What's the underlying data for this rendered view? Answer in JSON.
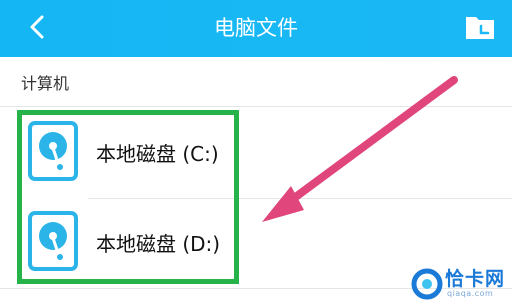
{
  "header": {
    "title": "电脑文件",
    "bg_color": "#1ab9f5"
  },
  "section": {
    "label": "计算机"
  },
  "disks": [
    {
      "label": "本地磁盘 (C:)",
      "icon": "hard-disk-icon"
    },
    {
      "label": "本地磁盘 (D:)",
      "icon": "hard-disk-icon"
    }
  ],
  "annotations": {
    "highlight_color": "#26b44a",
    "arrow_color": "#e0457b"
  },
  "watermark": {
    "text": "恰卡网",
    "sub": "qiaqa.com"
  }
}
